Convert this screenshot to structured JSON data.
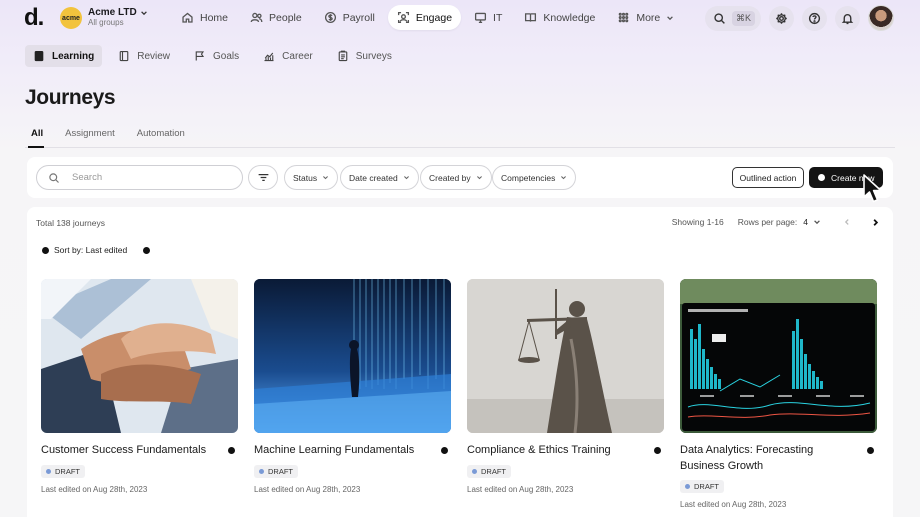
{
  "brand": {
    "logo_text": "d.",
    "org_badge": "acme",
    "org_name": "Acme LTD",
    "org_sub": "All groups"
  },
  "nav": [
    {
      "label": "Home",
      "icon": "home-icon"
    },
    {
      "label": "People",
      "icon": "people-icon"
    },
    {
      "label": "Payroll",
      "icon": "payroll-icon"
    },
    {
      "label": "Engage",
      "icon": "engage-icon",
      "active": true
    },
    {
      "label": "IT",
      "icon": "monitor-icon"
    },
    {
      "label": "Knowledge",
      "icon": "book-icon"
    },
    {
      "label": "More",
      "icon": "grid-icon"
    }
  ],
  "toolbar": {
    "shortcut": "⌘K"
  },
  "subnav": [
    {
      "label": "Learning",
      "icon": "learning-icon",
      "active": true
    },
    {
      "label": "Review",
      "icon": "review-icon"
    },
    {
      "label": "Goals",
      "icon": "flag-icon"
    },
    {
      "label": "Career",
      "icon": "chart-icon"
    },
    {
      "label": "Surveys",
      "icon": "survey-icon"
    }
  ],
  "page": {
    "title": "Journeys"
  },
  "tabs": [
    {
      "label": "All",
      "active": true
    },
    {
      "label": "Assignment"
    },
    {
      "label": "Automation"
    }
  ],
  "filters": {
    "search_placeholder": "Search",
    "chips": [
      "Status",
      "Date created",
      "Created by",
      "Competencies"
    ],
    "outlined_action": "Outlined action",
    "create_new": "Create new"
  },
  "list": {
    "total": "Total 138 journeys",
    "showing": "Showing 1-16",
    "rows_per_page_label": "Rows per page:",
    "rows_per_page_value": "4",
    "sort_label": "Sort by: Last edited"
  },
  "cards": [
    {
      "title": "Customer Success Fundamentals",
      "status": "DRAFT",
      "edited": "Last edited on Aug 28th, 2023"
    },
    {
      "title": "Machine Learning Fundamentals",
      "status": "DRAFT",
      "edited": "Last edited on Aug 28th, 2023"
    },
    {
      "title": "Compliance & Ethics Training",
      "status": "DRAFT",
      "edited": "Last edited on Aug 28th, 2023"
    },
    {
      "title": "Data Analytics: Forecasting Business Growth",
      "status": "DRAFT",
      "edited": "Last edited on Aug 28th, 2023"
    }
  ],
  "colors": {
    "accent": "#141414",
    "header_tint": "#ece6f8",
    "draft_dot": "#7a9ad6"
  }
}
